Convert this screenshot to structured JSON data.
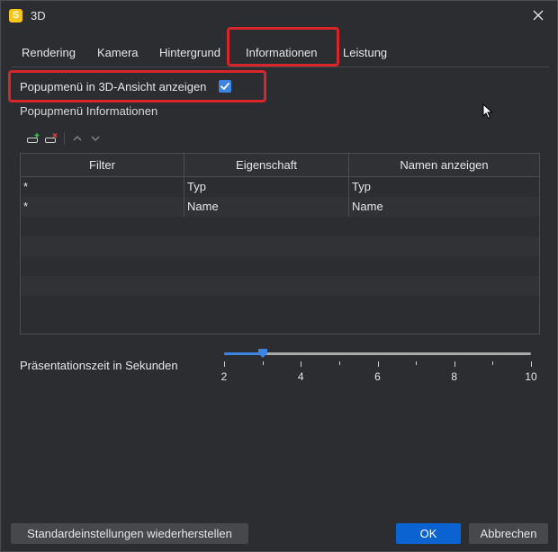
{
  "window": {
    "title": "3D",
    "app_icon_letter": "S",
    "close_icon": "close-icon"
  },
  "tabs": [
    {
      "label": "Rendering",
      "selected": false
    },
    {
      "label": "Kamera",
      "selected": false
    },
    {
      "label": "Hintergrund",
      "selected": false
    },
    {
      "label": "Informationen",
      "selected": true
    },
    {
      "label": "Leistung",
      "selected": false
    }
  ],
  "popup": {
    "checkbox_label": "Popupmenü in 3D-Ansicht anzeigen",
    "checked": true,
    "section_label": "Popupmenü Informationen"
  },
  "toolbar": {
    "icons": [
      "add-row-icon",
      "remove-row-icon",
      "move-up-icon",
      "move-down-icon"
    ]
  },
  "table": {
    "columns": [
      "Filter",
      "Eigenschaft",
      "Namen anzeigen"
    ],
    "rows": [
      [
        "*",
        "Typ",
        "Typ"
      ],
      [
        "*",
        "Name",
        "Name"
      ]
    ]
  },
  "slider": {
    "label": "Präsentationszeit in Sekunden",
    "min": 2,
    "max": 10,
    "value": 3,
    "tick_labels": [
      "2",
      "4",
      "6",
      "8",
      "10"
    ]
  },
  "buttons": {
    "restore_defaults": "Standardeinstellungen wiederherstellen",
    "ok": "OK",
    "cancel": "Abbrechen"
  },
  "colors": {
    "accent": "#3a84e3",
    "primary_button": "#0a63d1",
    "highlight": "#d7262a",
    "background": "#2b2d30"
  }
}
